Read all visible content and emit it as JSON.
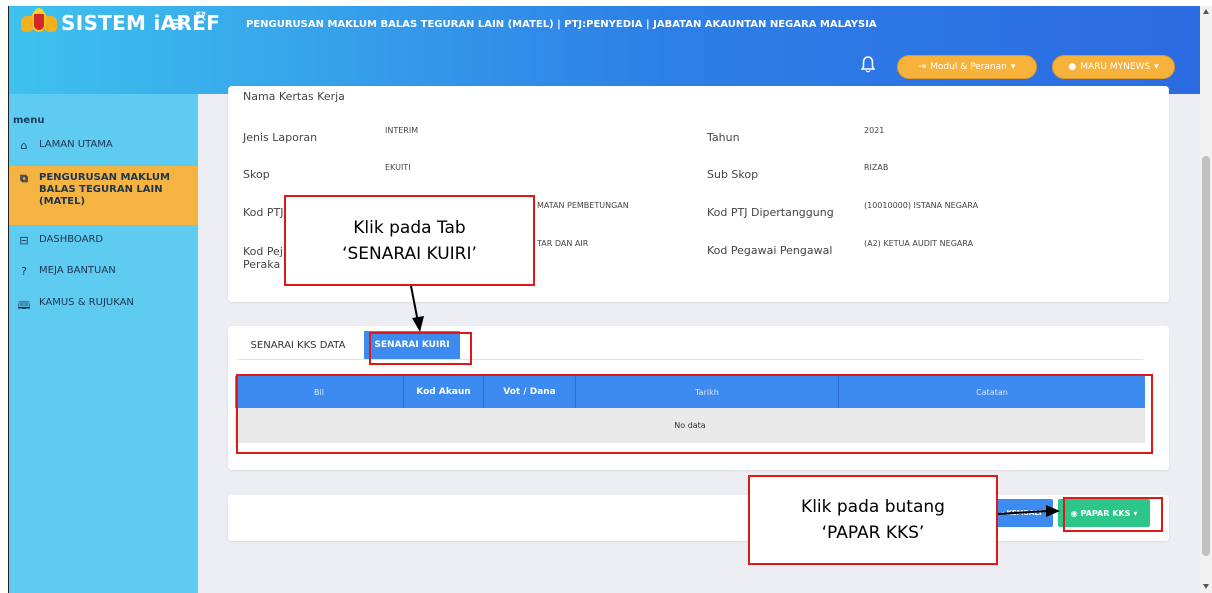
{
  "header": {
    "app_name": "SISTEM iAREF",
    "page_title": "PENGURUSAN MAKLUM BALAS TEGURAN LAIN (MATEL) | PTJ:PENYEDIA | JABATAN AKAUNTAN NEGARA MALAYSIA",
    "role_button": "Modul & Peranan",
    "user_button": "MARU MYNEWS",
    "icons": {
      "menu": "hamburger-icon",
      "expand": "expand-icon",
      "notify": "bell-icon",
      "role": "role-icon",
      "user": "user-icon"
    }
  },
  "sidebar": {
    "menu_label": "menu",
    "items": [
      {
        "label": "LAMAN UTAMA",
        "icon": "home-icon"
      },
      {
        "label_lines": [
          "PENGURUSAN MAKLUM",
          "BALAS TEGURAN LAIN",
          "(MATEL)"
        ],
        "icon": "copy-icon",
        "active": true
      },
      {
        "label": "DASHBOARD",
        "icon": "dashboard-icon"
      },
      {
        "label": "MEJA BANTUAN",
        "icon": "help-icon"
      },
      {
        "label": "KAMUS & RUJUKAN",
        "icon": "book-icon"
      }
    ]
  },
  "details": {
    "nama_kertas_kerja_label": "Nama Kertas Kerja",
    "jenis_laporan_label": "Jenis Laporan",
    "jenis_laporan_value": "INTERIM",
    "tahun_label": "Tahun",
    "tahun_value": "2021",
    "skop_label": "Skop",
    "skop_value": "EKUITI",
    "sub_skop_label": "Sub Skop",
    "sub_skop_value": "RIZAB",
    "kod_ptj_label": "Kod PTJ",
    "kod_ptj_value_partial": "MATAN PEMBETUNGAN",
    "kod_ptj_dipertanggung_label": "Kod PTJ Dipertanggung",
    "kod_ptj_dipertanggung_value": "(10010000) ISTANA NEGARA",
    "kod_pej_label_lines": [
      "Kod Pej",
      "Peraka"
    ],
    "kod_pej_value_partial": "TAR DAN AIR",
    "kod_pegawai_label": "Kod Pegawai Pengawal",
    "kod_pegawai_value": "(A2) KETUA AUDIT NEGARA"
  },
  "tabs": [
    {
      "label": "SENARAI KKS DATA",
      "active": false
    },
    {
      "label": "SENARAI KUIRI",
      "active": true
    }
  ],
  "table": {
    "columns": [
      "Bil",
      "Kod Akaun",
      "Vot / Dana",
      "Tarikh",
      "Catatan"
    ],
    "empty_text": "No data"
  },
  "actions": {
    "kembali": "KEMBALI",
    "papar_kks": "PAPAR KKS"
  },
  "annotations": {
    "callout_tab": [
      "Klik pada Tab",
      "‘SENARAI KUIRI’"
    ],
    "callout_button": [
      "Klik pada butang",
      "‘PAPAR KKS’"
    ]
  },
  "colors": {
    "header_start": "#3ec2ee",
    "header_end": "#2c6be3",
    "sidebar": "#5ecbf1",
    "active_item": "#f5b342",
    "primary": "#3d8bf0",
    "success": "#2cc68a",
    "annotation_red": "#e01818"
  }
}
